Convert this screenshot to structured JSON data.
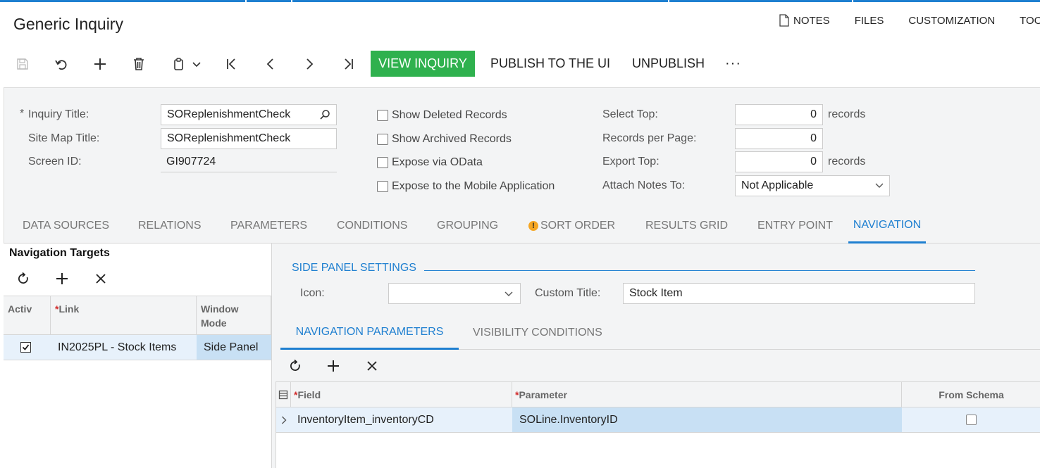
{
  "header": {
    "title": "Generic Inquiry",
    "links": [
      {
        "label": "NOTES",
        "icon": "note-icon"
      },
      {
        "label": "FILES"
      },
      {
        "label": "CUSTOMIZATION"
      },
      {
        "label": "TOO"
      }
    ]
  },
  "toolbar": {
    "view_inquiry": "VIEW INQUIRY",
    "publish": "PUBLISH TO THE UI",
    "unpublish": "UNPUBLISH",
    "more": "···",
    "accent": "#2fb14e"
  },
  "form": {
    "required_mark": "*",
    "inquiry_title_label": "Inquiry Title:",
    "inquiry_title_value": "SOReplenishmentCheck",
    "site_map_title_label": "Site Map Title:",
    "site_map_title_value": "SOReplenishmentCheck",
    "screen_id_label": "Screen ID:",
    "screen_id_value": "GI907724",
    "show_deleted": "Show Deleted Records",
    "show_archived": "Show Archived Records",
    "expose_odata": "Expose via OData",
    "expose_mobile": "Expose to the Mobile Application",
    "select_top_label": "Select Top:",
    "select_top_value": "0",
    "records": "records",
    "records_per_page_label": "Records per Page:",
    "records_per_page_value": "0",
    "export_top_label": "Export Top:",
    "export_top_value": "0",
    "attach_notes_label": "Attach Notes To:",
    "attach_notes_value": "Not Applicable"
  },
  "tabs": [
    "DATA SOURCES",
    "RELATIONS",
    "PARAMETERS",
    "CONDITIONS",
    "GROUPING",
    "SORT ORDER",
    "RESULTS GRID",
    "ENTRY POINT",
    "NAVIGATION"
  ],
  "tab_warning_mark": "!",
  "nav_targets": {
    "title": "Navigation Targets",
    "columns": {
      "active": "Activ",
      "link": "Link",
      "window_mode_1": "Window",
      "window_mode_2": "Mode"
    },
    "rows": [
      {
        "active": true,
        "link": "IN2025PL - Stock Items",
        "window_mode": "Side Panel"
      }
    ]
  },
  "side_panel": {
    "title": "SIDE PANEL SETTINGS",
    "icon_label": "Icon:",
    "custom_title_label": "Custom Title:",
    "custom_title_value": "Stock Item"
  },
  "sub_tabs": [
    "NAVIGATION PARAMETERS",
    "VISIBILITY CONDITIONS"
  ],
  "nav_params": {
    "columns": {
      "field": "Field",
      "parameter": "Parameter",
      "from_schema": "From Schema"
    },
    "rows": [
      {
        "field": "InventoryItem_inventoryCD",
        "parameter": "SOLine.InventoryID",
        "from_schema": false
      }
    ]
  },
  "colors": {
    "accent_blue": "#1e7fd0",
    "selected_row": "#c8e0f4"
  }
}
